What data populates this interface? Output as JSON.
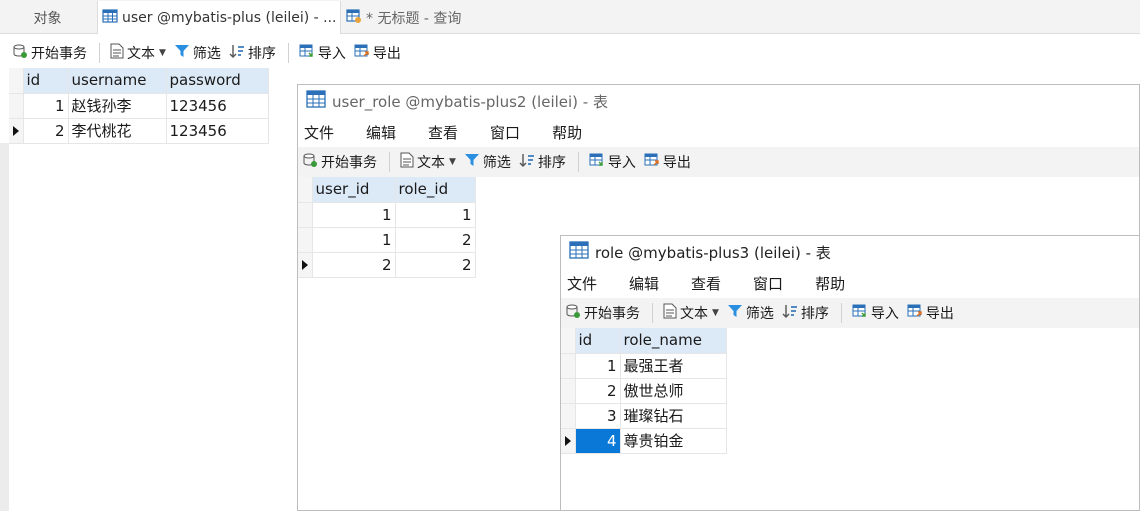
{
  "tabs": [
    {
      "label": "对象"
    },
    {
      "label": "user @mybatis-plus (leilei) - ..."
    },
    {
      "label": "* 无标题 - 查询"
    }
  ],
  "toolbar": {
    "begin_transaction": "开始事务",
    "text": "文本",
    "filter": "筛选",
    "sort": "排序",
    "import": "导入",
    "export": "导出"
  },
  "menu": [
    "文件",
    "编辑",
    "查看",
    "窗口",
    "帮助"
  ],
  "user_table": {
    "columns": [
      "id",
      "username",
      "password"
    ],
    "rows": [
      [
        "1",
        "赵钱孙李",
        "123456"
      ],
      [
        "2",
        "李代桃花",
        "123456"
      ]
    ]
  },
  "user_role_window": {
    "title": "user_role @mybatis-plus2 (leilei) - 表",
    "columns": [
      "user_id",
      "role_id"
    ],
    "rows": [
      [
        "1",
        "1"
      ],
      [
        "1",
        "2"
      ],
      [
        "2",
        "2"
      ]
    ]
  },
  "role_window": {
    "title": "role @mybatis-plus3 (leilei) - 表",
    "columns": [
      "id",
      "role_name"
    ],
    "rows": [
      [
        "1",
        "最强王者"
      ],
      [
        "2",
        "傲世总师"
      ],
      [
        "3",
        "璀璨钻石"
      ],
      [
        "4",
        "尊贵铂金"
      ]
    ]
  },
  "colors": {
    "header_bg": "#dce9f7",
    "selection": "#0a78d7",
    "icon_blue": "#2a6fb8"
  }
}
